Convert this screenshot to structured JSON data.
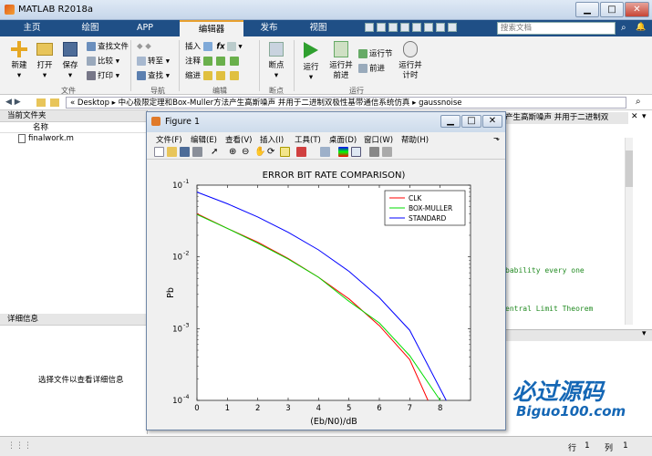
{
  "app": {
    "title": "MATLAB R2018a"
  },
  "tabs": [
    "主页",
    "绘图",
    "APP",
    "编辑器",
    "发布",
    "视图"
  ],
  "search": {
    "placeholder": "搜索文档"
  },
  "ribbon": {
    "new_label": "新建",
    "open_label": "打开",
    "save_label": "保存",
    "find_files": "查找文件",
    "compare": "比较",
    "print": "打印",
    "group_file": "文件",
    "goto": "转至",
    "find": "查找",
    "group_nav": "导航",
    "insert": "插入",
    "comment": "注释",
    "indent": "缩进",
    "group_edit": "编辑",
    "breakpoints": "断点",
    "group_bp": "断点",
    "run": "运行",
    "run_advance": "运行并前进",
    "run_section": "运行节",
    "advance": "前进",
    "run_time": "运行并计时",
    "group_run": "运行"
  },
  "address": {
    "crumbs": [
      "Desktop",
      "中心极限定理和Box-Muller方法产生高斯噪声 并用于二进制双极性基带通信系统仿真",
      "gaussnoise"
    ]
  },
  "current_folder": {
    "title": "当前文件夹",
    "col_name": "名称",
    "files": [
      "finalwork.m"
    ]
  },
  "details": {
    "title": "详细信息",
    "hint": "选择文件以查看详细信息"
  },
  "editor": {
    "tab_text": "产生高斯噪声 并用于二进制双",
    "lines": [
      "bability every one",
      "entral Limit Theorem"
    ]
  },
  "status": {
    "row_label": "行",
    "row_value": "1",
    "col_label": "列",
    "col_value": "1"
  },
  "figure": {
    "title": "Figure 1",
    "menu": [
      "文件(F)",
      "编辑(E)",
      "查看(V)",
      "插入(I)",
      "工具(T)",
      "桌面(D)",
      "窗口(W)",
      "帮助(H)"
    ]
  },
  "watermark": {
    "cn": "必过源码",
    "en": "Biguo100.com"
  },
  "colors": {
    "clk": "#ff0000",
    "box": "#00dd00",
    "std": "#0000ff",
    "tabbar": "#1f4f86"
  },
  "chart_data": {
    "type": "line",
    "title": "ERROR BIT RATE COMPARISON)",
    "xlabel": "(Eb/N0)/dB",
    "ylabel": "Pb",
    "xlim": [
      0,
      9
    ],
    "ylim": [
      0.0001,
      0.1
    ],
    "yscale": "log",
    "xticks": [
      0,
      1,
      2,
      3,
      4,
      5,
      6,
      7,
      8
    ],
    "yticks": [
      {
        "base": "10",
        "exp": "-1"
      },
      {
        "base": "10",
        "exp": "-2"
      },
      {
        "base": "10",
        "exp": "-3"
      },
      {
        "base": "10",
        "exp": "-4"
      }
    ],
    "legend_position": "top-right",
    "series": [
      {
        "name": "CLK",
        "x": [
          0,
          1,
          2,
          3,
          4,
          5,
          6,
          7,
          7.6
        ],
        "y": [
          0.04,
          0.025,
          0.016,
          0.0095,
          0.0052,
          0.0026,
          0.0011,
          0.00037,
          0.0001
        ]
      },
      {
        "name": "BOX-MULLER",
        "x": [
          0,
          1,
          2,
          3,
          4,
          5,
          6,
          7,
          8
        ],
        "y": [
          0.039,
          0.025,
          0.0155,
          0.0093,
          0.0052,
          0.0024,
          0.0012,
          0.00042,
          0.0001
        ]
      },
      {
        "name": "STANDARD",
        "x": [
          0,
          1,
          2,
          3,
          4,
          5,
          6,
          7,
          8.2
        ],
        "y": [
          0.08,
          0.055,
          0.036,
          0.022,
          0.0125,
          0.0063,
          0.0027,
          0.00095,
          0.0001
        ]
      }
    ]
  }
}
